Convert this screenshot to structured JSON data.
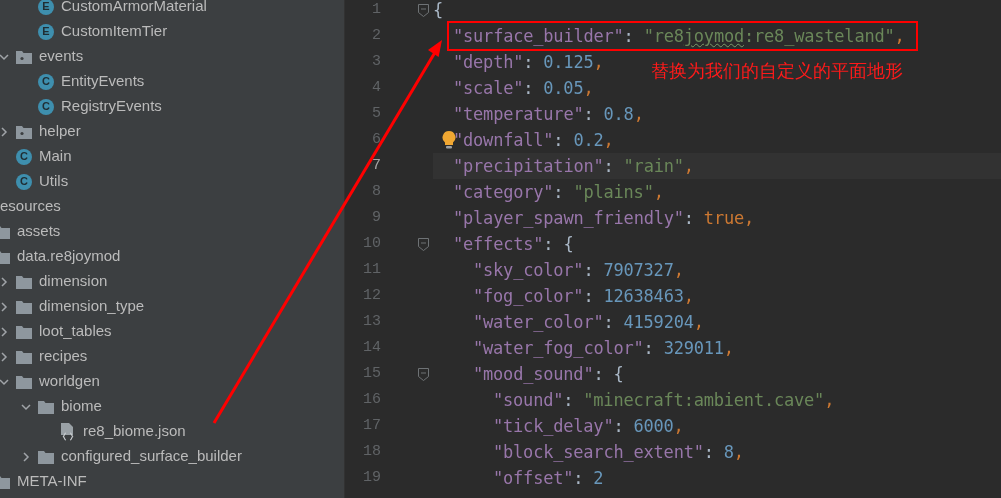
{
  "project_tree": {
    "continued": [
      {
        "label": "CustomArmorMaterial",
        "kind": "enum",
        "badge": "E"
      },
      {
        "label": "CustomItemTier",
        "kind": "enum",
        "badge": "E"
      }
    ],
    "items": [
      {
        "label": "events",
        "kind": "package",
        "expanded": true,
        "children": [
          {
            "label": "EntityEvents",
            "kind": "class",
            "badge": "C"
          },
          {
            "label": "RegistryEvents",
            "kind": "class",
            "badge": "C"
          }
        ]
      },
      {
        "label": "helper",
        "kind": "package",
        "expanded": false
      },
      {
        "label": "Main",
        "kind": "class",
        "badge": "C"
      },
      {
        "label": "Utils",
        "kind": "class",
        "badge": "C"
      }
    ],
    "resources": [
      {
        "label": "esources",
        "kind": "label",
        "children": [
          {
            "label": "assets",
            "kind": "folder"
          },
          {
            "label": "data.re8joymod",
            "kind": "folder",
            "children": [
              {
                "label": "dimension",
                "kind": "folder",
                "expanded": false
              },
              {
                "label": "dimension_type",
                "kind": "folder",
                "expanded": false
              },
              {
                "label": "loot_tables",
                "kind": "folder",
                "expanded": false
              },
              {
                "label": "recipes",
                "kind": "folder",
                "expanded": false
              },
              {
                "label": "worldgen",
                "kind": "folder",
                "expanded": true,
                "children": [
                  {
                    "label": "biome",
                    "kind": "folder",
                    "expanded": true,
                    "children": [
                      {
                        "label": "re8_biome.json",
                        "kind": "json"
                      }
                    ]
                  },
                  {
                    "label": "configured_surface_builder",
                    "kind": "folder",
                    "expanded": false
                  }
                ]
              }
            ]
          },
          {
            "label": "META-INF",
            "kind": "folder"
          }
        ]
      }
    ]
  },
  "editor": {
    "lines": [
      {
        "number": "1",
        "current": false,
        "hint": false,
        "tokens": [
          {
            "kind": "open",
            "text": "{"
          }
        ]
      },
      {
        "number": "2",
        "current": false,
        "hint": false,
        "framed": true,
        "tokens": [
          {
            "kind": "key",
            "text": "\"surface_builder\""
          },
          {
            "kind": "colon",
            "text": ":"
          },
          {
            "kind": "string",
            "text": "\"re8"
          },
          {
            "kind": "string",
            "text": "joymod",
            "typo": true
          },
          {
            "kind": "string",
            "text": ":re8_wasteland\""
          },
          {
            "kind": "punct",
            "text": ","
          }
        ]
      },
      {
        "number": "3",
        "current": false,
        "hint": false,
        "tokens": [
          {
            "kind": "key",
            "text": "\"depth\""
          },
          {
            "kind": "colon",
            "text": ":"
          },
          {
            "kind": "number",
            "text": "0.125"
          },
          {
            "kind": "punct",
            "text": ","
          }
        ]
      },
      {
        "number": "4",
        "current": false,
        "hint": false,
        "tokens": [
          {
            "kind": "key",
            "text": "\"scale\""
          },
          {
            "kind": "colon",
            "text": ":"
          },
          {
            "kind": "number",
            "text": "0.05"
          },
          {
            "kind": "punct",
            "text": ","
          }
        ]
      },
      {
        "number": "5",
        "current": false,
        "hint": false,
        "tokens": [
          {
            "kind": "key",
            "text": "\"temperature\""
          },
          {
            "kind": "colon",
            "text": ":"
          },
          {
            "kind": "number",
            "text": "0.8"
          },
          {
            "kind": "punct",
            "text": ","
          }
        ]
      },
      {
        "number": "6",
        "current": false,
        "hint": true,
        "tokens": [
          {
            "kind": "key",
            "text": "\"downfall\""
          },
          {
            "kind": "colon",
            "text": ":"
          },
          {
            "kind": "number",
            "text": "0.2"
          },
          {
            "kind": "punct",
            "text": ","
          }
        ]
      },
      {
        "number": "7",
        "current": true,
        "hint": false,
        "tokens": [
          {
            "kind": "key",
            "text": "\"precipitation\""
          },
          {
            "kind": "colon",
            "text": ":"
          },
          {
            "kind": "string",
            "text": "\"rain\""
          },
          {
            "kind": "punct",
            "text": ","
          }
        ]
      },
      {
        "number": "8",
        "current": false,
        "hint": false,
        "tokens": [
          {
            "kind": "key",
            "text": "\"category\""
          },
          {
            "kind": "colon",
            "text": ":"
          },
          {
            "kind": "string",
            "text": "\"plains\""
          },
          {
            "kind": "punct",
            "text": ","
          }
        ]
      },
      {
        "number": "9",
        "current": false,
        "hint": false,
        "tokens": [
          {
            "kind": "key",
            "text": "\"player_spawn_friendly\""
          },
          {
            "kind": "colon",
            "text": ":"
          },
          {
            "kind": "keyword",
            "text": "true"
          },
          {
            "kind": "punct",
            "text": ","
          }
        ]
      },
      {
        "number": "10",
        "current": false,
        "hint": false,
        "tokens": [
          {
            "kind": "key",
            "text": "\"effects\""
          },
          {
            "kind": "colon",
            "text": ":"
          },
          {
            "kind": "open",
            "text": "{"
          }
        ]
      },
      {
        "number": "11",
        "current": false,
        "hint": false,
        "tokens": [
          {
            "kind": "key",
            "text": "\"sky_color\""
          },
          {
            "kind": "colon",
            "text": ":"
          },
          {
            "kind": "number",
            "text": "7907327"
          },
          {
            "kind": "punct",
            "text": ","
          }
        ]
      },
      {
        "number": "12",
        "current": false,
        "hint": false,
        "tokens": [
          {
            "kind": "key",
            "text": "\"fog_color\""
          },
          {
            "kind": "colon",
            "text": ":"
          },
          {
            "kind": "number",
            "text": "12638463"
          },
          {
            "kind": "punct",
            "text": ","
          }
        ]
      },
      {
        "number": "13",
        "current": false,
        "hint": false,
        "tokens": [
          {
            "kind": "key",
            "text": "\"water_color\""
          },
          {
            "kind": "colon",
            "text": ":"
          },
          {
            "kind": "number",
            "text": "4159204"
          },
          {
            "kind": "punct",
            "text": ","
          }
        ]
      },
      {
        "number": "14",
        "current": false,
        "hint": false,
        "tokens": [
          {
            "kind": "key",
            "text": "\"water_fog_color\""
          },
          {
            "kind": "colon",
            "text": ":"
          },
          {
            "kind": "number",
            "text": "329011"
          },
          {
            "kind": "punct",
            "text": ","
          }
        ]
      },
      {
        "number": "15",
        "current": false,
        "hint": false,
        "tokens": [
          {
            "kind": "key",
            "text": "\"mood_sound\""
          },
          {
            "kind": "colon",
            "text": ":"
          },
          {
            "kind": "open",
            "text": "{"
          }
        ]
      },
      {
        "number": "16",
        "current": false,
        "hint": false,
        "tokens": [
          {
            "kind": "key",
            "text": "\"sound\""
          },
          {
            "kind": "colon",
            "text": ":"
          },
          {
            "kind": "string",
            "text": "\"minecraft:ambient.cave\""
          },
          {
            "kind": "punct",
            "text": ","
          }
        ]
      },
      {
        "number": "17",
        "current": false,
        "hint": false,
        "tokens": [
          {
            "kind": "key",
            "text": "\"tick_delay\""
          },
          {
            "kind": "colon",
            "text": ":"
          },
          {
            "kind": "number",
            "text": "6000"
          },
          {
            "kind": "punct",
            "text": ","
          }
        ]
      },
      {
        "number": "18",
        "current": false,
        "hint": false,
        "tokens": [
          {
            "kind": "key",
            "text": "\"block_search_extent\""
          },
          {
            "kind": "colon",
            "text": ":"
          },
          {
            "kind": "number",
            "text": "8"
          },
          {
            "kind": "punct",
            "text": ","
          }
        ]
      },
      {
        "number": "19",
        "current": false,
        "hint": false,
        "tokens": [
          {
            "kind": "key",
            "text": "\"offset\""
          },
          {
            "kind": "colon",
            "text": ":"
          },
          {
            "kind": "number",
            "text": "2"
          }
        ]
      }
    ]
  },
  "callout": {
    "note": "替换为我们的自定义的平面地形"
  }
}
